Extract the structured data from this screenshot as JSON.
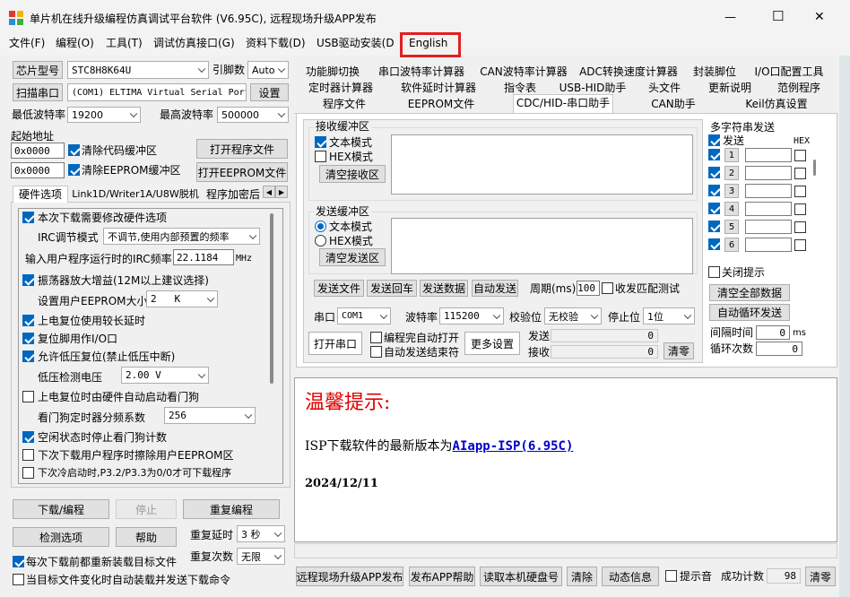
{
  "window": {
    "title": "单片机在线升级编程仿真调试平台软件 (V6.95C), 远程现场升级APP发布",
    "min": "—",
    "max": "☐",
    "close": "✕"
  },
  "menu": [
    "文件(F)",
    "编程(O)",
    "工具(T)",
    "调试仿真接口(G)",
    "资料下载(D)",
    "USB驱动安装(D",
    "English"
  ],
  "left": {
    "chip_label": "芯片型号",
    "chip_value": "STC8H8K64U",
    "pins_label": "引脚数",
    "pins_value": "Auto",
    "scan_btn": "扫描串口",
    "port_value": "(COM1) ELTIMA Virtual Serial Port",
    "settings_btn": "设置",
    "min_baud_label": "最低波特率",
    "min_baud_value": "19200",
    "max_baud_label": "最高波特率",
    "max_baud_value": "500000",
    "start_addr_label": "起始地址",
    "addr1": "0x0000",
    "clear_code_label": "清除代码缓冲区",
    "open_prog_btn": "打开程序文件",
    "addr2": "0x0000",
    "clear_eeprom_label": "清除EEPROM缓冲区",
    "open_eeprom_btn": "打开EEPROM文件",
    "tabs": [
      "硬件选项",
      "Link1D/Writer1A/U8W脱机",
      "程序加密后"
    ],
    "hw": {
      "opt_modify": "本次下载需要修改硬件选项",
      "irc_mode_label": "IRC调节模式",
      "irc_mode_value": "不调节,使用内部预置的频率",
      "irc_freq_label": "输入用户程序运行时的IRC频率",
      "irc_freq_value": "22.1184",
      "irc_unit": "MHz",
      "osc_gain": "振荡器放大增益(12M以上建议选择)",
      "eeprom_size_label": "设置用户EEPROM大小",
      "eeprom_size_value": "2   K",
      "long_delay": "上电复位使用较长延时",
      "reset_io": "复位脚用作I/O口",
      "lvr": "允许低压复位(禁止低压中断)",
      "lvd_label": "低压检测电压",
      "lvd_value": "2.00 V",
      "wdt_auto": "上电复位时由硬件自动启动看门狗",
      "wdt_div_label": "看门狗定时器分频系数",
      "wdt_div_value": "256",
      "idle_wdt": "空闲状态时停止看门狗计数",
      "erase_eeprom": "下次下载用户程序时擦除用户EEPROM区",
      "cold_boot": "下次冷启动时,P3.2/P3.3为0/0才可下载程序"
    },
    "download_btn": "下载/编程",
    "stop_btn": "停止",
    "reprog_btn": "重复编程",
    "check_btn": "检测选项",
    "help_btn": "帮助",
    "repeat_delay_label": "重复延时",
    "repeat_delay_value": "3 秒",
    "repeat_count_label": "重复次数",
    "repeat_count_value": "无限",
    "reload_label": "每次下载前都重新装载目标文件",
    "auto_send_label": "当目标文件变化时自动装载并发送下载命令"
  },
  "right_tabs": {
    "row1": [
      "功能脚切换",
      "串口波特率计算器",
      "CAN波特率计算器",
      "ADC转换速度计算器",
      "封装脚位",
      "I/O口配置工具"
    ],
    "row2": [
      "定时器计算器",
      "软件延时计算器",
      "指令表",
      "USB-HID助手",
      "头文件",
      "更新说明",
      "范例程序"
    ],
    "row3": [
      "程序文件",
      "EEPROM文件",
      "CDC/HID-串口助手",
      "CAN助手",
      "Keil仿真设置"
    ]
  },
  "serial": {
    "recv_group": "接收缓冲区",
    "recv_text_mode": "文本模式",
    "recv_hex_mode": "HEX模式",
    "recv_clear": "清空接收区",
    "send_group": "发送缓冲区",
    "send_text_mode": "文本模式",
    "send_hex_mode": "HEX模式",
    "send_clear": "清空发送区",
    "send_file": "发送文件",
    "send_enter": "发送回车",
    "send_data": "发送数据",
    "auto_send": "自动发送",
    "period_label": "周期(ms)",
    "period_value": "100",
    "match_test": "收发匹配测试",
    "port_label": "串口",
    "port_value": "COM1",
    "baud_label": "波特率",
    "baud_value": "115200",
    "parity_label": "校验位",
    "parity_value": "无校验",
    "stop_label": "停止位",
    "stop_value": "1位",
    "open_port": "打开串口",
    "auto_open": "编程完自动打开",
    "auto_end": "自动发送结束符",
    "more_settings": "更多设置",
    "tx_label": "发送",
    "tx_value": "0",
    "rx_label": "接收",
    "rx_value": "0",
    "clear_counts": "清零"
  },
  "multi": {
    "title": "多字符串发送",
    "send_header": "发送",
    "hex_header": "HEX",
    "rows": [
      "1",
      "2",
      "3",
      "4",
      "5",
      "6"
    ],
    "close_hint": "关闭提示",
    "clear_all": "清空全部数据",
    "auto_loop": "自动循环发送",
    "interval_label": "间隔时间",
    "interval_value": "0",
    "interval_unit": "ms",
    "loop_label": "循环次数",
    "loop_value": "0"
  },
  "notice": {
    "title": "温馨提示:",
    "line": "ISP下载软件的最新版本为",
    "link": "AIapp-ISP(6.95C)",
    "date": "2024/12/11"
  },
  "bottom": {
    "publish": "远程现场升级APP发布",
    "publish_help": "发布APP帮助",
    "read_disk": "读取本机硬盘号",
    "clear": "清除",
    "dynamic": "动态信息",
    "beep": "提示音",
    "success_label": "成功计数",
    "success_value": "98",
    "clear_zero": "清零"
  },
  "colors": {
    "highlight_box": "#e02020",
    "notice_title": "#e00000",
    "link": "#0000cc",
    "accent": "#0067c0"
  }
}
